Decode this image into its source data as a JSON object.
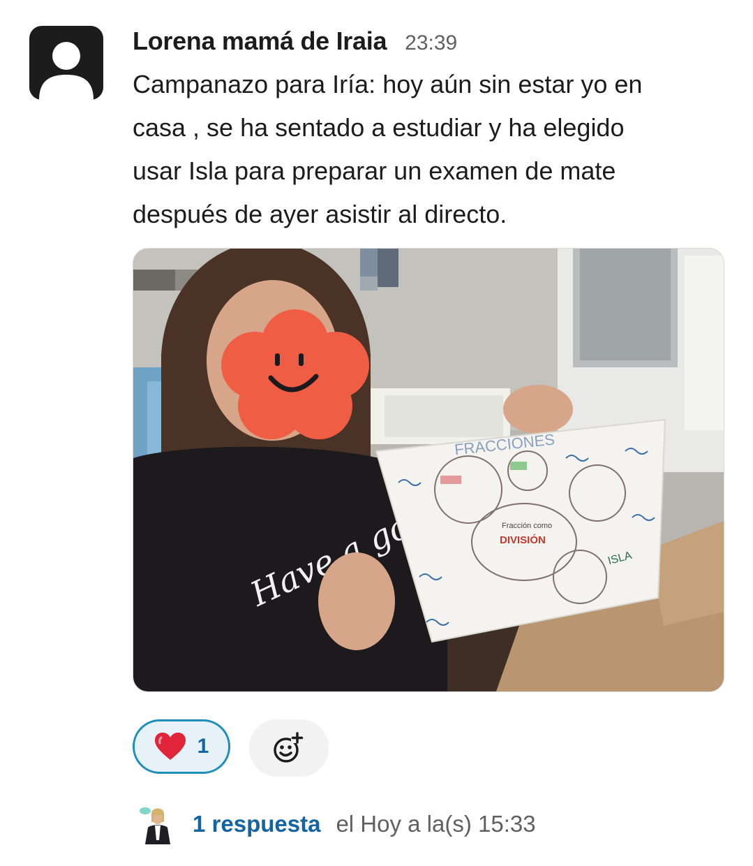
{
  "message": {
    "author": "Lorena mamá de Iraia",
    "time": "23:39",
    "text_lines": [
      "Campanazo para Iría: hoy aún sin estar yo en",
      "casa , se ha sentado a estudiar y ha elegido",
      "usar Isla para preparar un examen de mate",
      "después de ayer asistir al directo."
    ]
  },
  "attachment": {
    "shirt_text": "Have a go",
    "paper_title": "FRACCIONES",
    "paper_center": "DIVISIÓN",
    "paper_center_label": "Fracción como",
    "paper_brand": "ISLA"
  },
  "reactions": [
    {
      "emoji": "heart-icon",
      "count": "1",
      "color": "#e01e5a"
    }
  ],
  "thread": {
    "replies_label": "1 respuesta",
    "last_reply": "el Hoy a la(s) 15:33"
  },
  "colors": {
    "link": "#1264a3",
    "reaction_border": "#1d8eb8",
    "reaction_bg": "#e6f2f8"
  }
}
